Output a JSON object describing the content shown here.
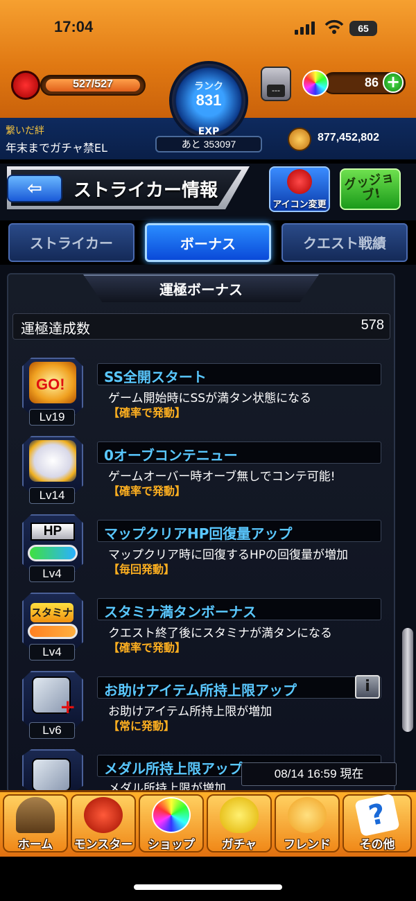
{
  "status": {
    "time": "17:04",
    "battery": "65"
  },
  "header": {
    "stamina": "527/527",
    "rank_label": "ランク",
    "rank": "831",
    "exp_label": "EXP",
    "exp_remaining": "あと 353097",
    "orbs": "86",
    "box_label": "---",
    "bond_title": "繋いだ絆",
    "bond_text": "年末までガチャ禁EL",
    "gold": "877,452,802"
  },
  "title_bar": {
    "title": "ストライカー情報",
    "icon_change_label": "アイコン変更",
    "good_job_label": "グッジョブ!"
  },
  "tabs": [
    {
      "label": "ストライカー",
      "active": false
    },
    {
      "label": "ボーナス",
      "active": true
    },
    {
      "label": "クエスト戦績",
      "active": false
    }
  ],
  "section": {
    "title": "運極ボーナス",
    "count_label": "運極達成数",
    "count_value": "578"
  },
  "bonuses": [
    {
      "name": "SS全開スタート",
      "level": "Lv19",
      "desc": "ゲーム開始時にSSが満タン状態になる",
      "note": "【確率で発動】",
      "icon": "go-badge-icon"
    },
    {
      "name": "0オーブコンテニュー",
      "level": "Lv14",
      "desc": "ゲームオーバー時オーブ無しでコンテ可能!",
      "note": "【確率で発動】",
      "icon": "winged-arrow-icon"
    },
    {
      "name": "マップクリアHP回復量アップ",
      "level": "Lv4",
      "desc": "マップクリア時に回復するHPの回復量が増加",
      "note": "【毎回発動】",
      "icon": "hp-gauge-icon"
    },
    {
      "name": "スタミナ満タンボーナス",
      "level": "Lv4",
      "desc": "クエスト終了後にスタミナが満タンになる",
      "note": "【確率で発動】",
      "icon": "stamina-gauge-icon"
    },
    {
      "name": "お助けアイテム所持上限アップ",
      "level": "Lv6",
      "desc": "お助けアイテム所持上限が増加",
      "note": "【常に発動】",
      "icon": "helper-item-icon"
    },
    {
      "name": "メダル所持上限アップ",
      "level": "",
      "desc": "メダル所持上限が増加",
      "note": "",
      "icon": "medal-plus-icon"
    }
  ],
  "info_button": "i",
  "timestamp": "08/14 16:59 現在",
  "nav": [
    {
      "label": "ホーム",
      "icon": "home-gate-icon"
    },
    {
      "label": "モンスター",
      "icon": "dragon-icon"
    },
    {
      "label": "ショップ",
      "icon": "orb-icon"
    },
    {
      "label": "ガチャ",
      "icon": "egg-icon"
    },
    {
      "label": "フレンド",
      "icon": "friends-icon"
    },
    {
      "label": "その他",
      "icon": "question-icon"
    }
  ]
}
